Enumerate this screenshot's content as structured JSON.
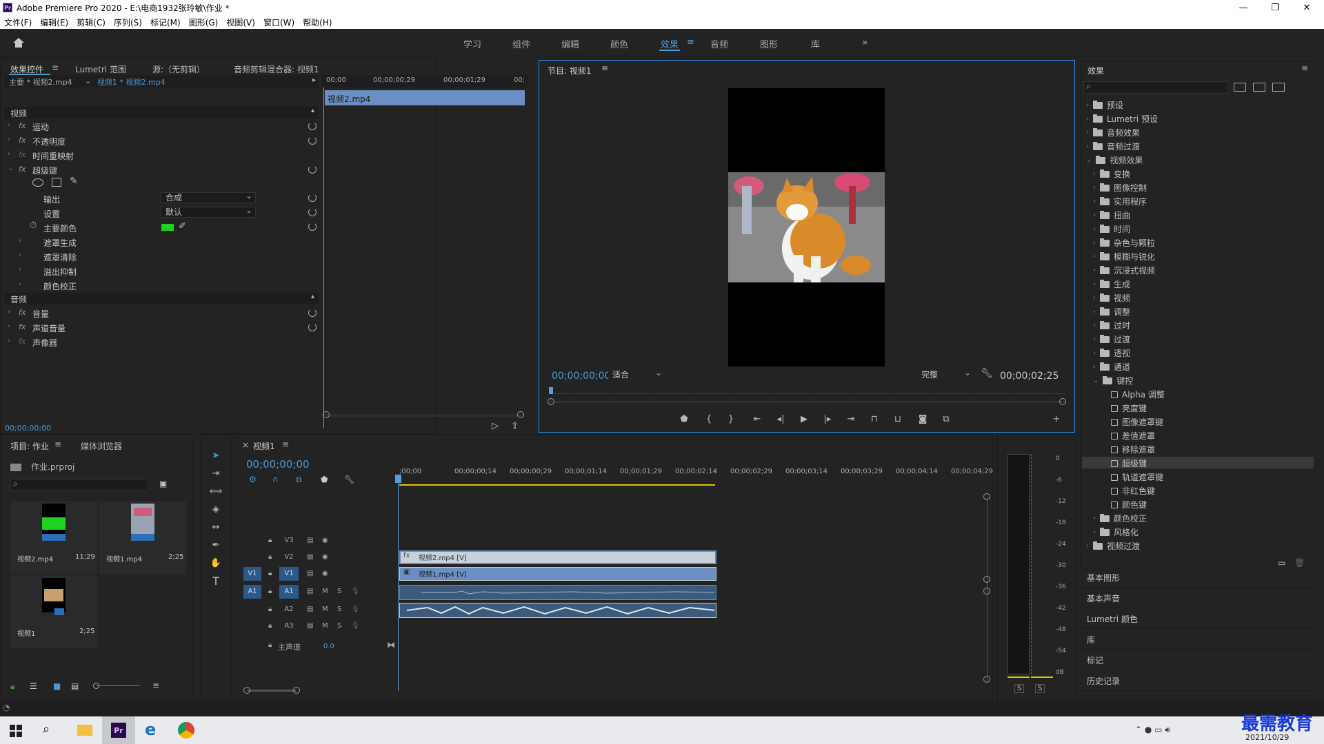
{
  "window": {
    "title": "Adobe Premiere Pro 2020 - E:\\电商1932张玲敏\\作业 *",
    "logo": "Pr"
  },
  "menu": [
    "文件(F)",
    "编辑(E)",
    "剪辑(C)",
    "序列(S)",
    "标记(M)",
    "图形(G)",
    "视图(V)",
    "窗口(W)",
    "帮助(H)"
  ],
  "workspaces": [
    "学习",
    "组件",
    "编辑",
    "颜色",
    "效果",
    "音频",
    "图形",
    "库"
  ],
  "active_workspace": "效果",
  "effect_controls": {
    "tabs": [
      "效果控件",
      "Lumetri 范围",
      "源:（无剪辑）",
      "音频剪辑混合器: 视频1"
    ],
    "master_label": "主要 * 视频2.mp4",
    "sequence_label": "视频1 * 视频2.mp4",
    "ruler": [
      "00;00",
      "00;00;00;29",
      "00;00;01;29",
      "00;"
    ],
    "clip_label": "视频2.mp4",
    "video_header": "视频",
    "audio_header": "音频",
    "rows": {
      "motion": "运动",
      "opacity": "不透明度",
      "time_remap": "时间重映射",
      "ultra_key": "超级键",
      "output": "输出",
      "output_val": "合成",
      "setting": "设置",
      "setting_val": "默认",
      "key_color": "主要颜色",
      "matte_gen": "遮罩生成",
      "matte_clean": "遮罩清除",
      "spill": "溢出抑制",
      "color_corr": "颜色校正",
      "volume": "音量",
      "channel_vol": "声道音量",
      "panner": "声像器"
    },
    "timecode": "00;00;00;00",
    "key_color_hex": "#1fd21f"
  },
  "program": {
    "title": "节目: 视频1",
    "timecode": "00;00;00;00",
    "fit": "适合",
    "quality": "完整",
    "duration": "00;00;02;25"
  },
  "project": {
    "tabs": [
      "项目: 作业",
      "媒体浏览器"
    ],
    "file": "作业.prproj",
    "items": [
      {
        "name": "视频2.mp4",
        "dur": "11;29"
      },
      {
        "name": "视频1.mp4",
        "dur": "2;25"
      },
      {
        "name": "视频1",
        "dur": "2;25"
      }
    ]
  },
  "timeline": {
    "tab": "视频1",
    "timecode": "00;00;00;00",
    "ruler": [
      ";00;00",
      "00;00;00;14",
      "00;00;00;29",
      "00;00;01;14",
      "00;00;01;29",
      "00;00;02;14",
      "00;00;02;29",
      "00;00;03;14",
      "00;00;03;29",
      "00;00;04;14",
      "00;00;04;29"
    ],
    "tracks": {
      "v3": "V3",
      "v2": "V2",
      "v1": "V1",
      "a1": "A1",
      "a2": "A2",
      "a3": "A3",
      "m": "M",
      "s": "S"
    },
    "master": "主声道",
    "master_val": "0.0",
    "clip_v2": "视频2.mp4 [V]",
    "clip_v1": "视频1.mp4 [V]"
  },
  "meter": {
    "scale": [
      "0",
      "-6",
      "-12",
      "-18",
      "-24",
      "-30",
      "-36",
      "-42",
      "-48",
      "-54",
      "dB"
    ],
    "s": "S"
  },
  "effects": {
    "title": "效果",
    "tree": [
      {
        "label": "预设",
        "lvl": 0,
        "open": false,
        "type": "bin"
      },
      {
        "label": "Lumetri 预设",
        "lvl": 0,
        "open": false,
        "type": "bin"
      },
      {
        "label": "音频效果",
        "lvl": 0,
        "open": false,
        "type": "folder"
      },
      {
        "label": "音频过渡",
        "lvl": 0,
        "open": false,
        "type": "folder"
      },
      {
        "label": "视频效果",
        "lvl": 0,
        "open": true,
        "type": "folder"
      },
      {
        "label": "变换",
        "lvl": 1,
        "open": false,
        "type": "folder"
      },
      {
        "label": "图像控制",
        "lvl": 1,
        "open": false,
        "type": "folder"
      },
      {
        "label": "实用程序",
        "lvl": 1,
        "open": false,
        "type": "folder"
      },
      {
        "label": "扭曲",
        "lvl": 1,
        "open": false,
        "type": "folder"
      },
      {
        "label": "时间",
        "lvl": 1,
        "open": false,
        "type": "folder"
      },
      {
        "label": "杂色与颗粒",
        "lvl": 1,
        "open": false,
        "type": "folder"
      },
      {
        "label": "模糊与锐化",
        "lvl": 1,
        "open": false,
        "type": "folder"
      },
      {
        "label": "沉浸式视频",
        "lvl": 1,
        "open": false,
        "type": "folder"
      },
      {
        "label": "生成",
        "lvl": 1,
        "open": false,
        "type": "folder"
      },
      {
        "label": "视频",
        "lvl": 1,
        "open": false,
        "type": "folder"
      },
      {
        "label": "调整",
        "lvl": 1,
        "open": false,
        "type": "folder"
      },
      {
        "label": "过时",
        "lvl": 1,
        "open": false,
        "type": "folder"
      },
      {
        "label": "过渡",
        "lvl": 1,
        "open": false,
        "type": "folder"
      },
      {
        "label": "透视",
        "lvl": 1,
        "open": false,
        "type": "folder"
      },
      {
        "label": "通道",
        "lvl": 1,
        "open": false,
        "type": "folder"
      },
      {
        "label": "键控",
        "lvl": 1,
        "open": true,
        "type": "folder"
      },
      {
        "label": "Alpha 调整",
        "lvl": 2,
        "type": "fx"
      },
      {
        "label": "亮度键",
        "lvl": 2,
        "type": "fx"
      },
      {
        "label": "图像遮罩键",
        "lvl": 2,
        "type": "fx"
      },
      {
        "label": "差值遮罩",
        "lvl": 2,
        "type": "fx"
      },
      {
        "label": "移除遮罩",
        "lvl": 2,
        "type": "fx"
      },
      {
        "label": "超级键",
        "lvl": 2,
        "type": "fx",
        "selected": true
      },
      {
        "label": "轨道遮罩键",
        "lvl": 2,
        "type": "fx"
      },
      {
        "label": "非红色键",
        "lvl": 2,
        "type": "fx"
      },
      {
        "label": "颜色键",
        "lvl": 2,
        "type": "fx"
      },
      {
        "label": "颜色校正",
        "lvl": 1,
        "open": false,
        "type": "folder"
      },
      {
        "label": "风格化",
        "lvl": 1,
        "open": false,
        "type": "folder"
      },
      {
        "label": "视频过渡",
        "lvl": 0,
        "open": false,
        "type": "folder"
      }
    ],
    "side_panels": [
      "基本图形",
      "基本声音",
      "Lumetri 颜色",
      "库",
      "标记",
      "历史记录"
    ]
  },
  "taskbar": {
    "date": "2021/10/29",
    "watermark": "最需教育"
  }
}
